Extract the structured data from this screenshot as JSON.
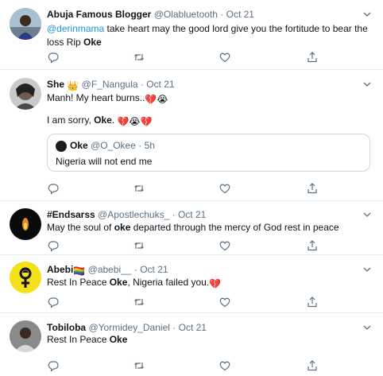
{
  "tweets": [
    {
      "name": "Abuja Famous Blogger",
      "handle": "@Olabluetooth",
      "dot": "·",
      "time": "Oct 21",
      "mention": "@derinmama",
      "text_a": " take heart may the good lord give you the fortitude to bear the loss Rip ",
      "text_bold": "Oke"
    },
    {
      "name": "She ",
      "crown": "👑",
      "handle": "@F_Nangula",
      "dot": "·",
      "time": "Oct 21",
      "line1": "Manh! My heart burns..",
      "line1_emoji": "💔😭",
      "line2_a": "I am sorry, ",
      "line2_bold": "Oke",
      "line2_b": ". ",
      "line2_emoji": "💔😭💔",
      "quote": {
        "name": "Oke",
        "handle": "@O_Okee",
        "dot": "·",
        "time": "5h",
        "text": "Nigeria will not end me"
      }
    },
    {
      "name": "#Endsarss",
      "handle": "@Apostlechuks_",
      "dot": "·",
      "time": "Oct 21",
      "text_a": "May the soul of ",
      "text_bold": "oke",
      "text_b": " departed through the mercy of God rest in peace"
    },
    {
      "name": "Abebi",
      "flag": "🏳️‍🌈",
      "handle": "@abebi__",
      "dot": "·",
      "time": "Oct 21",
      "text_a": "Rest In Peace ",
      "text_bold": "Oke",
      "text_b": ", Nigeria failed you.",
      "emoji": "💔"
    },
    {
      "name": "Tobiloba",
      "handle": "@Yormidey_Daniel",
      "dot": "·",
      "time": "Oct 21",
      "text_a": "Rest In Peace ",
      "text_bold": "Oke"
    }
  ],
  "icons": {
    "reply": "reply-icon",
    "retweet": "retweet-icon",
    "like": "like-icon",
    "share": "share-icon",
    "caret": "chevron-down-icon"
  },
  "colors": {
    "mention": "#1b95e0",
    "secondary": "#5b7083",
    "divider": "#e6ecf0"
  }
}
